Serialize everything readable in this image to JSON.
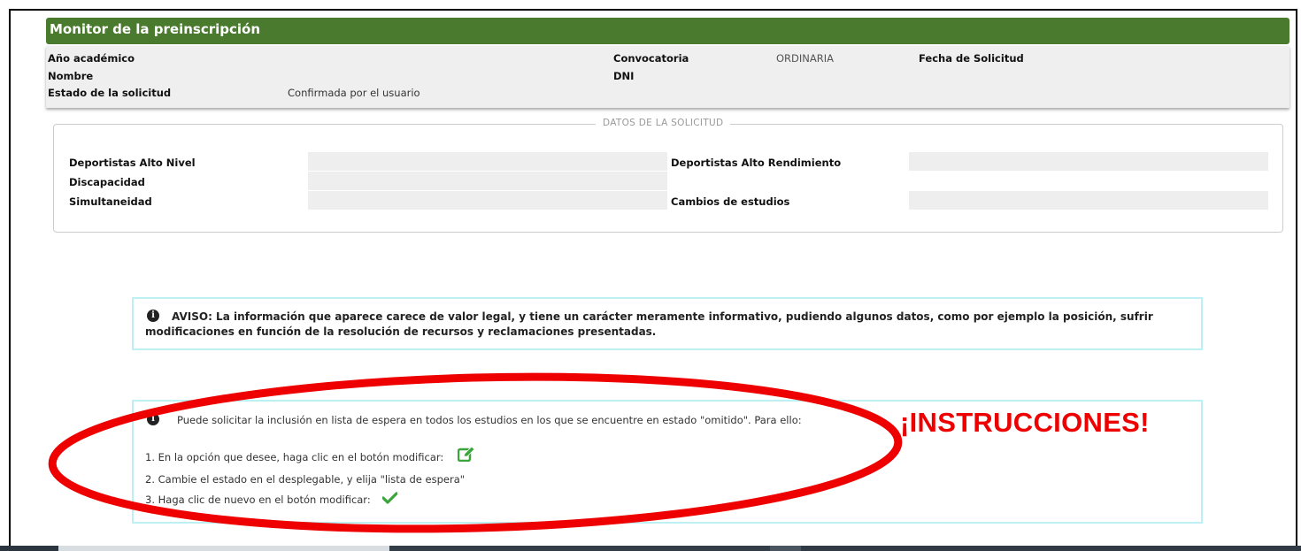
{
  "header": {
    "title": "Monitor de la preinscripción"
  },
  "info": {
    "academic_year_label": "Año académico",
    "name_label": "Nombre",
    "status_label": "Estado de la solicitud",
    "status_value": "Confirmada por el usuario",
    "convocatoria_label": "Convocatoria",
    "convocatoria_value": "ORDINARIA",
    "dni_label": "DNI",
    "fecha_label": "Fecha de Solicitud"
  },
  "datos": {
    "legend": "DATOS DE LA SOLICITUD",
    "alto_nivel_label": "Deportistas Alto Nivel",
    "discapacidad_label": "Discapacidad",
    "simultaneidad_label": "Simultaneidad",
    "alto_rendimiento_label": "Deportistas Alto Rendimiento",
    "cambios_label": "Cambios de estudios"
  },
  "aviso": {
    "text": "AVISO: La información que aparece carece de valor legal, y tiene un carácter meramente informativo, pudiendo algunos datos, como por ejemplo la posición, sufrir modificaciones en función de la resolución de recursos y reclamaciones presentadas."
  },
  "instructions": {
    "intro": "Puede solicitar la inclusión en lista de espera en todos los estudios en los que se encuentre en estado \"omitido\". Para ello:",
    "step1": "1. En la opción que desee, haga clic en el botón modificar:",
    "step2": "2. Cambie el estado en el desplegable, y elija \"lista de espera\"",
    "step3": "3. Haga clic de nuevo en el botón modificar:",
    "annotation": "¡INSTRUCCIONES!"
  },
  "icons": {
    "info": "info-icon",
    "edit": "edit-icon",
    "check": "check-icon"
  },
  "colors": {
    "header_green": "#4a7a2d",
    "alert_border": "#bdf0f3",
    "annotation_red": "#ee0000",
    "icon_green": "#3aa53a"
  }
}
